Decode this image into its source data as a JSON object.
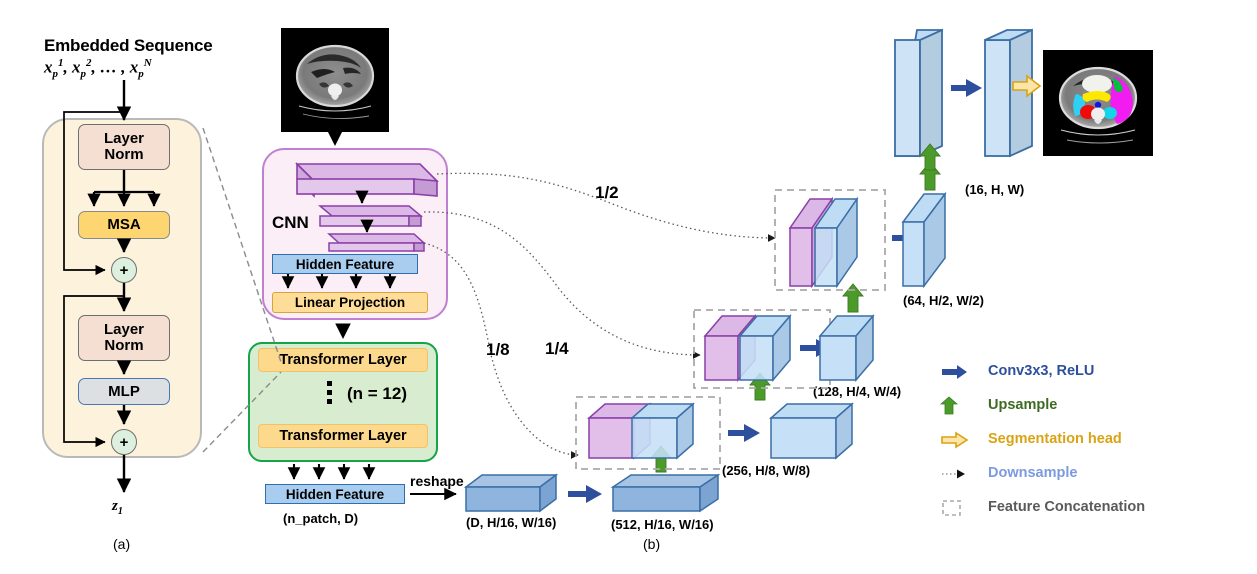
{
  "figure": {
    "panel_a_label": "(a)",
    "panel_b_label": "(b)",
    "title_line1": "Embedded Sequence",
    "title_line2_plain": "x_p^1, x_p^2, ... , x_p^N",
    "output_symbol": "z",
    "output_symbol_sub": "1"
  },
  "panel_a": {
    "layer_norm_1": "Layer Norm",
    "layer_norm_1_l1": "Layer",
    "layer_norm_1_l2": "Norm",
    "msa": "MSA",
    "layer_norm_2_l1": "Layer",
    "layer_norm_2_l2": "Norm",
    "mlp": "MLP",
    "residual_1": "+",
    "residual_2": "+",
    "colors": {
      "card_bg": "#fdf3dc",
      "layer_norm": "#f5ded2",
      "msa": "#fdd571",
      "mlp": "#dde0e3",
      "residual": "#ddf0df"
    }
  },
  "cnn": {
    "label": "CNN",
    "hidden_feature": "Hidden Feature",
    "linear_projection": "Linear Projection",
    "card_border": "#c07fd0",
    "card_bg": "#fbeef6",
    "slab_color": "#d6b2e0"
  },
  "transformer": {
    "layer_top": "Transformer Layer",
    "layer_bottom": "Transformer Layer",
    "repeat": "(n = 12)",
    "hidden_feature": "Hidden Feature",
    "hidden_feature_dim": "(n_patch, D)",
    "reshape": "reshape",
    "card_bg": "#d8ecd0",
    "card_border": "#16a34a",
    "layer_color": "#fcd98c"
  },
  "skip_connections": [
    {
      "name": "half",
      "label": "1/2"
    },
    {
      "name": "quarter",
      "label": "1/4"
    },
    {
      "name": "eighth",
      "label": "1/8"
    }
  ],
  "decoder": {
    "stages": [
      {
        "name": "bottleneck-reshape",
        "label": "(D, H/16, W/16)"
      },
      {
        "name": "bottleneck-conv",
        "label": "(512, H/16, W/16)"
      },
      {
        "name": "stage-8",
        "label": "(256, H/8, W/8)"
      },
      {
        "name": "stage-4",
        "label": "(128, H/4, W/4)"
      },
      {
        "name": "stage-2",
        "label": "(64, H/2, W/2)"
      },
      {
        "name": "stage-1",
        "label": "(16, H, W)"
      }
    ]
  },
  "legend": {
    "items": [
      {
        "icon": "blue-solid-arrow-right-icon",
        "label": "Conv3x3, ReLU",
        "color": "#2d4f9e"
      },
      {
        "icon": "green-solid-arrow-up-icon",
        "label": "Upsample",
        "color": "#3d6b23"
      },
      {
        "icon": "yellow-outline-arrow-right-icon",
        "label": "Segmentation head",
        "color": "#d9a315"
      },
      {
        "icon": "dotted-arrow-right-icon",
        "label": "Downsample",
        "color": "#7b9ae0"
      },
      {
        "icon": "dashed-rectangle-icon",
        "label": "Feature Concatenation",
        "color": "#5a5a5a"
      }
    ]
  },
  "images": {
    "input_scan": "abdominal-ct-axial-slice",
    "output_scan": "abdominal-ct-axial-slice-with-organ-segmentation-overlay"
  }
}
